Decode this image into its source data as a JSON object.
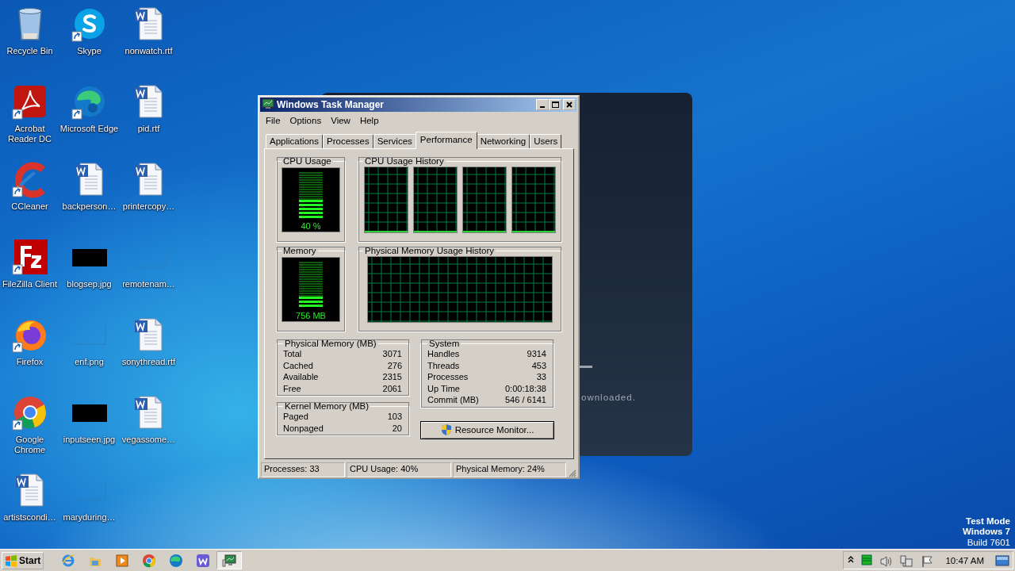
{
  "desktop_icons": [
    {
      "label": "Recycle Bin",
      "kind": "recycle",
      "shortcut": false
    },
    {
      "label": "Acrobat Reader DC",
      "kind": "acrobat",
      "shortcut": true
    },
    {
      "label": "CCleaner",
      "kind": "ccleaner",
      "shortcut": true
    },
    {
      "label": "FileZilla Client",
      "kind": "filezilla",
      "shortcut": true
    },
    {
      "label": "Firefox",
      "kind": "firefox",
      "shortcut": true
    },
    {
      "label": "Google Chrome",
      "kind": "chrome",
      "shortcut": true
    },
    {
      "label": "artistscondi…",
      "kind": "word",
      "shortcut": false
    },
    {
      "label": "Skype",
      "kind": "skype",
      "shortcut": true
    },
    {
      "label": "Microsoft Edge",
      "kind": "edge",
      "shortcut": true
    },
    {
      "label": "backperson…",
      "kind": "word",
      "shortcut": false
    },
    {
      "label": "blogsep.jpg",
      "kind": "dark-image",
      "shortcut": false
    },
    {
      "label": "enf.png",
      "kind": "blank-image",
      "shortcut": false
    },
    {
      "label": "inputseen.jpg",
      "kind": "dark-image",
      "shortcut": false
    },
    {
      "label": "maryduring…",
      "kind": "blank-image",
      "shortcut": false
    },
    {
      "label": "nonwatch.rtf",
      "kind": "word",
      "shortcut": false
    },
    {
      "label": "pid.rtf",
      "kind": "word",
      "shortcut": false
    },
    {
      "label": "printercopy…",
      "kind": "word",
      "shortcut": false
    },
    {
      "label": "remotenam…",
      "kind": "blank-image",
      "shortcut": false
    },
    {
      "label": "sonythread.rtf",
      "kind": "word",
      "shortcut": false
    },
    {
      "label": "vegassome…",
      "kind": "word",
      "shortcut": false
    }
  ],
  "background_window": {
    "text": "ownloaded."
  },
  "task_manager": {
    "title": "Windows Task Manager",
    "menu": [
      "File",
      "Options",
      "View",
      "Help"
    ],
    "tabs": [
      {
        "label": "Applications",
        "selected": false
      },
      {
        "label": "Processes",
        "selected": false
      },
      {
        "label": "Services",
        "selected": false
      },
      {
        "label": "Performance",
        "selected": true
      },
      {
        "label": "Networking",
        "selected": false
      },
      {
        "label": "Users",
        "selected": false
      }
    ],
    "cpu_usage": {
      "title": "CPU Usage",
      "level": 0.4,
      "reading": "40 %"
    },
    "cpu_history": {
      "title": "CPU Usage History"
    },
    "memory": {
      "title": "Memory",
      "level": 0.25,
      "reading": "756 MB"
    },
    "memory_history": {
      "title": "Physical Memory Usage History"
    },
    "physical_memory": {
      "title": "Physical Memory (MB)",
      "rows": [
        {
          "label": "Total",
          "value": "3071"
        },
        {
          "label": "Cached",
          "value": "276"
        },
        {
          "label": "Available",
          "value": "2315"
        },
        {
          "label": "Free",
          "value": "2061"
        }
      ]
    },
    "kernel_memory": {
      "title": "Kernel Memory (MB)",
      "rows": [
        {
          "label": "Paged",
          "value": "103"
        },
        {
          "label": "Nonpaged",
          "value": "20"
        }
      ]
    },
    "system": {
      "title": "System",
      "rows": [
        {
          "label": "Handles",
          "value": "9314"
        },
        {
          "label": "Threads",
          "value": "453"
        },
        {
          "label": "Processes",
          "value": "33"
        },
        {
          "label": "Up Time",
          "value": "0:00:18:38"
        },
        {
          "label": "Commit (MB)",
          "value": "546 / 6141"
        }
      ]
    },
    "resource_monitor_button": "Resource Monitor...",
    "status_bar": [
      "Processes: 33",
      "CPU Usage: 40%",
      "Physical Memory: 24%"
    ]
  },
  "test_mode_notice": {
    "title": "Test Mode",
    "edition": "Windows 7",
    "build": "Build 7601"
  },
  "taskbar": {
    "start": "Start",
    "items": [
      {
        "kind": "ie",
        "active": false
      },
      {
        "kind": "explorer",
        "active": false
      },
      {
        "kind": "media",
        "active": false
      },
      {
        "kind": "chrome",
        "active": false
      },
      {
        "kind": "edge",
        "active": false
      },
      {
        "kind": "w-app",
        "active": false
      },
      {
        "kind": "task-manager",
        "active": true
      }
    ],
    "tray": [
      {
        "kind": "chevron"
      },
      {
        "kind": "cpu-meter"
      },
      {
        "kind": "speaker"
      },
      {
        "kind": "network"
      },
      {
        "kind": "flag"
      }
    ],
    "clock": "10:47 AM"
  }
}
